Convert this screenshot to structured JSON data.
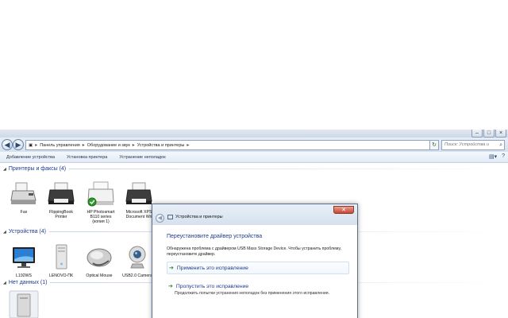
{
  "explorer": {
    "address": [
      "Панель управления",
      "Оборудование и звук",
      "Устройства и принтеры"
    ],
    "search_placeholder": "Поиск: Устройства и принте...",
    "commands": [
      "Добавление устройства",
      "Установка принтера",
      "Устранение неполадок"
    ],
    "groups": {
      "printers": {
        "header": "Принтеры и факсы (4)",
        "items": [
          {
            "line1": "Fax",
            "line2": "",
            "line3": "",
            "icon": "fax-icon"
          },
          {
            "line1": "FlippingBook",
            "line2": "Printer",
            "line3": "",
            "icon": "printer-icon"
          },
          {
            "line1": "HP Photosmart",
            "line2": "B110 series",
            "line3": "(копия 1)",
            "icon": "printer-default-icon"
          },
          {
            "line1": "Microsoft XPS",
            "line2": "Document Wri",
            "line3": "",
            "icon": "printer-icon"
          }
        ]
      },
      "devices": {
        "header": "Устройства (4)",
        "items": [
          {
            "line1": "L192WS",
            "icon": "monitor-icon"
          },
          {
            "line1": "LENOVO-ПК",
            "icon": "computer-icon"
          },
          {
            "line1": "Optical Mouse",
            "icon": "mouse-icon"
          },
          {
            "line1": "USB2.0 Camera",
            "icon": "webcam-icon"
          }
        ]
      },
      "no_data": {
        "header": "Нет данных (1)"
      }
    }
  },
  "dialog": {
    "title": "Устройства и принтеры",
    "heading": "Переустановите драйвер устройства",
    "message": "Обнаружена проблема с драйвером USB Mass Storage Device. Чтобы устранить проблему, переустановите драйвер.",
    "option_apply": "Применить это исправление",
    "option_skip": "Пропустить это исправление",
    "option_skip_desc": "Продолжить попытки устранения неполадок без применения этого исправления."
  }
}
